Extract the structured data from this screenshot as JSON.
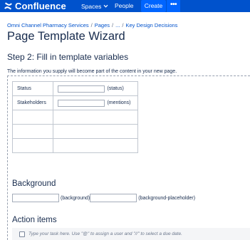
{
  "topbar": {
    "logo_text": "Confluence",
    "logo_icon": "confluence-logo-icon",
    "spaces_label": "Spaces",
    "people_label": "People",
    "create_label": "Create",
    "more_label": "•••",
    "colors": {
      "bar": "#0052cc",
      "create": "#0065ff"
    }
  },
  "breadcrumb": {
    "items": [
      "Omni Channel Pharmacy Services",
      "Pages",
      "...",
      "Key Design Decisions"
    ],
    "separator": "/"
  },
  "page": {
    "title": "Page Template Wizard",
    "step_heading": "Step 2: Fill in template variables",
    "intro": "The information you supply will become part of the content in your new page."
  },
  "variables_table": {
    "rows": [
      {
        "label": "Status",
        "value": "",
        "suffix": "(status)"
      },
      {
        "label": "Stakeholders",
        "value": "",
        "suffix": "(mentions)"
      },
      {
        "label": "",
        "value": "",
        "suffix": ""
      },
      {
        "label": "",
        "value": "",
        "suffix": ""
      },
      {
        "label": "",
        "value": "",
        "suffix": ""
      }
    ]
  },
  "background_section": {
    "heading": "Background",
    "field1_value": "",
    "field1_suffix": "(background)",
    "field2_value": "",
    "field2_suffix": "(background-placeholder)"
  },
  "action_items": {
    "heading": "Action items",
    "task_placeholder": "Type your task here. Use \"@\" to assign a user and \"//\" to select a due date."
  }
}
